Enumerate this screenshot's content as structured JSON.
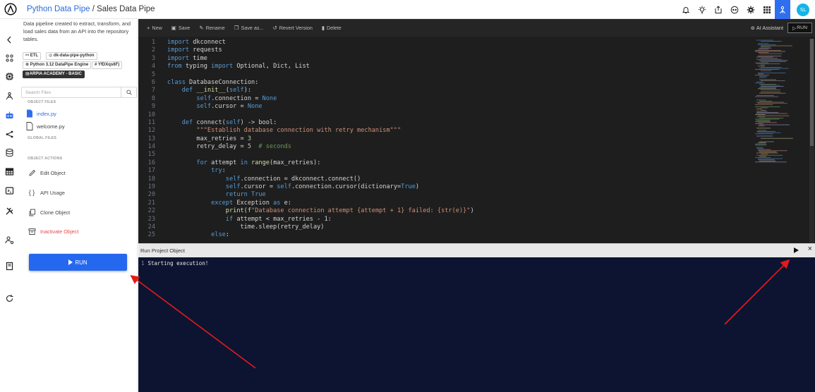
{
  "breadcrumb": {
    "project": "Python Data Pipe",
    "separator": " / ",
    "current": "Sales Data Pipe"
  },
  "topbar_icons": [
    "bell-icon",
    "bulb-icon",
    "export-icon",
    "view-icon",
    "settings-icon",
    "grid-icon",
    "user-network-icon"
  ],
  "user": {
    "initials": "SL"
  },
  "rail_icons": [
    "chevron-left-icon",
    "apps-icon",
    "chip-icon",
    "network-icon",
    "robot-icon",
    "share-icon",
    "database-icon",
    "table-icon",
    "terminal-icon",
    "tools-icon",
    "user-settings-icon",
    "book-icon",
    "refresh-icon"
  ],
  "panel": {
    "description": "Data pipeline created to extract, transform, and load sales data from an API into the repository tables.",
    "tags": {
      "etl": "ETL",
      "container": "dk-data-pipe-python",
      "engine": "Python 3.12 DataPipe Engine",
      "id": "YfDXqs6F)",
      "academy": "ARPIA ACADEMY - BASIC"
    },
    "search_placeholder": "Search Files",
    "object_files_label": "OBJECT FILES",
    "files": [
      "index.py",
      "welcome.py"
    ],
    "global_files_label": "GLOBAL FILES",
    "object_actions_label": "OBJECT ACTIONS",
    "actions": {
      "edit": "Edit Object",
      "api": "API Usage",
      "clone": "Clone Object",
      "inactivate": "Inactivate Object"
    },
    "run_label": "RUN"
  },
  "toolbar": {
    "new": "New",
    "save": "Save",
    "rename": "Rename",
    "save_as": "Save as...",
    "revert": "Revert Version",
    "delete": "Delete",
    "ai_assistant": "AI Assistant",
    "run": "RUN"
  },
  "code_lines": [
    [
      [
        "kw",
        "import"
      ],
      [
        "t",
        " dkconnect"
      ]
    ],
    [
      [
        "kw",
        "import"
      ],
      [
        "t",
        " requests"
      ]
    ],
    [
      [
        "kw",
        "import"
      ],
      [
        "t",
        " time"
      ]
    ],
    [
      [
        "kw",
        "from"
      ],
      [
        "t",
        " typing "
      ],
      [
        "kw",
        "import"
      ],
      [
        "t",
        " Optional, Dict, List"
      ]
    ],
    [],
    [
      [
        "kw",
        "class"
      ],
      [
        "t",
        " DatabaseConnection:"
      ]
    ],
    [
      [
        "t",
        "    "
      ],
      [
        "kw",
        "def"
      ],
      [
        "t",
        " "
      ],
      [
        "fn",
        "__init__"
      ],
      [
        "t",
        "("
      ],
      [
        "self",
        "self"
      ],
      [
        "t",
        "):"
      ]
    ],
    [
      [
        "t",
        "        "
      ],
      [
        "self",
        "self"
      ],
      [
        "t",
        ".connection = "
      ],
      [
        "kw",
        "None"
      ]
    ],
    [
      [
        "t",
        "        "
      ],
      [
        "self",
        "self"
      ],
      [
        "t",
        ".cursor = "
      ],
      [
        "kw",
        "None"
      ]
    ],
    [],
    [
      [
        "t",
        "    "
      ],
      [
        "kw",
        "def"
      ],
      [
        "t",
        " connect("
      ],
      [
        "self",
        "self"
      ],
      [
        "t",
        ") -> bool:"
      ]
    ],
    [
      [
        "t",
        "        "
      ],
      [
        "str",
        "\"\"\"Establish database connection with retry mechanism\"\"\""
      ]
    ],
    [
      [
        "t",
        "        max_retries = "
      ],
      [
        "num",
        "3"
      ]
    ],
    [
      [
        "t",
        "        retry_delay = "
      ],
      [
        "num",
        "5"
      ],
      [
        "t",
        "  "
      ],
      [
        "cm",
        "# seconds"
      ]
    ],
    [],
    [
      [
        "t",
        "        "
      ],
      [
        "kw",
        "for"
      ],
      [
        "t",
        " attempt "
      ],
      [
        "kw",
        "in"
      ],
      [
        "t",
        " "
      ],
      [
        "fn",
        "range"
      ],
      [
        "t",
        "(max_retries):"
      ]
    ],
    [
      [
        "t",
        "            "
      ],
      [
        "kw",
        "try"
      ],
      [
        "t",
        ":"
      ]
    ],
    [
      [
        "t",
        "                "
      ],
      [
        "self",
        "self"
      ],
      [
        "t",
        ".connection = dkconnect.connect()"
      ]
    ],
    [
      [
        "t",
        "                "
      ],
      [
        "self",
        "self"
      ],
      [
        "t",
        ".cursor = "
      ],
      [
        "self",
        "self"
      ],
      [
        "t",
        ".connection.cursor(dictionary="
      ],
      [
        "kw",
        "True"
      ],
      [
        "t",
        ")"
      ]
    ],
    [
      [
        "t",
        "                "
      ],
      [
        "kw",
        "return"
      ],
      [
        "t",
        " "
      ],
      [
        "kw",
        "True"
      ]
    ],
    [
      [
        "t",
        "            "
      ],
      [
        "kw",
        "except"
      ],
      [
        "t",
        " Exception "
      ],
      [
        "kw",
        "as"
      ],
      [
        "t",
        " e:"
      ]
    ],
    [
      [
        "t",
        "                "
      ],
      [
        "fn",
        "print"
      ],
      [
        "t",
        "(f"
      ],
      [
        "str",
        "\"Database connection attempt {attempt + 1} failed: {str(e)}\""
      ],
      [
        "t",
        ")"
      ]
    ],
    [
      [
        "t",
        "                "
      ],
      [
        "kw",
        "if"
      ],
      [
        "t",
        " attempt < max_retries - 1:"
      ]
    ],
    [
      [
        "t",
        "                    time.sleep(retry_delay)"
      ]
    ],
    [
      [
        "t",
        "            "
      ],
      [
        "kw",
        "else"
      ],
      [
        "t",
        ":"
      ]
    ]
  ],
  "run_panel": {
    "title": "Run Project Object",
    "console_lines": [
      "Starting execution!"
    ]
  },
  "colors": {
    "accent": "#2568f0",
    "link": "#2d6bd8",
    "editor_bg": "#1e1e1e",
    "console_bg": "#0d1431",
    "annotation_arrow": "#e31b1b",
    "danger": "#e44a4a"
  }
}
